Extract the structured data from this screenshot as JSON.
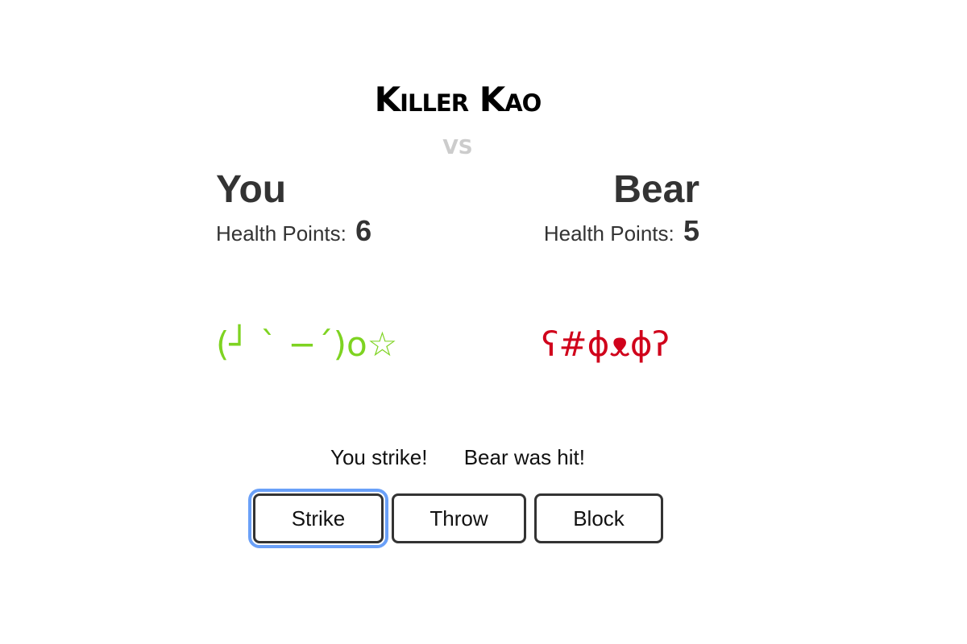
{
  "header": {
    "title": "Killer Kao",
    "vs": "vs"
  },
  "players": {
    "you": {
      "name": "You",
      "hp_label": "Health Points:",
      "hp": "6",
      "kaomoji": "(┘ ` −´)o☆",
      "color": "#7ed321"
    },
    "bear": {
      "name": "Bear",
      "hp_label": "Health Points:",
      "hp": "5",
      "kaomoji": "ʕ#ϕᴥϕʔ",
      "color": "#d0021b"
    }
  },
  "messages": {
    "player_action": "You strike!",
    "opponent_result": "Bear was hit!"
  },
  "actions": {
    "strike": "Strike",
    "throw": "Throw",
    "block": "Block",
    "focused": "Strike"
  }
}
